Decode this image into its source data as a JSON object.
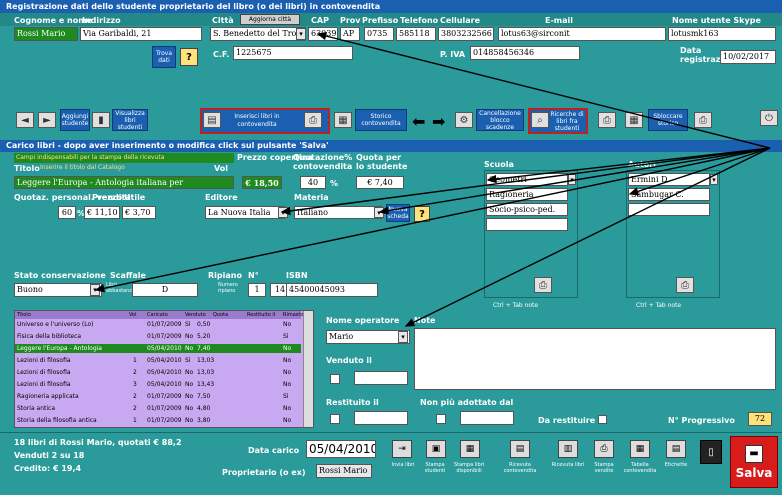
{
  "header": {
    "title": "Registrazione dati dello studente proprietario del libro (o dei libri) in contovendita",
    "cols": [
      "Cognome e nome",
      "Indirizzo",
      "Città",
      "CAP",
      "Prov",
      "Prefisso",
      "Telefono",
      "Cellulare",
      "E-mail",
      "Nome utente Skype"
    ],
    "aggiorna_citta": "Aggiorna città",
    "nome": "Rossi Mario",
    "indirizzo": "Via Garibaldi, 21",
    "citta": "S. Benedetto del Tronto",
    "cap": "63039",
    "prov": "AP",
    "prefisso": "0735",
    "telefono": "585118",
    "cellulare": "3803232566",
    "email": "lotus63@sirconit",
    "skype": "lotusmk163",
    "trova_btn": "Trova dati",
    "cf_label": "C.F.",
    "cf_value": "1225675",
    "piva_label": "P. IVA",
    "piva_value": "014858456346",
    "data_reg_label": "Data registrazione",
    "data_reg": "10/02/2017"
  },
  "toolbar": {
    "items": [
      "",
      "Aggiungi studente",
      "Visualizza libri studenti",
      "Inserisci libri in contovendita",
      "",
      "Storico contovendita",
      "",
      "",
      "Cancellazione blocco scadenze",
      "Ricerche di libri fra studenti",
      "",
      "Sbloccare storico",
      ""
    ]
  },
  "carico": {
    "title": "Carico libri - dopo aver inserimento o modifica click sul pulsante 'Salva'",
    "hint": "Campi indispensabili per la stampa della ricevuta",
    "titolo_label": "Titolo",
    "titolo_sub": "Inserire il titolo dal Catalogo",
    "vol_label": "Vol",
    "prezzo_copertina_label": "Prezzo copertina",
    "quotazione_label": "Quotazione% contovendita",
    "quota_label": "Quota per lo studente",
    "titolo": "Leggere l'Europa - Antologia italiana per",
    "prezzo_copertina": "€ 18,50",
    "quotazione": "40",
    "pct": "%",
    "quota": "€ 7,40",
    "quotaz_label": "Quotaz. personal. vendita",
    "quotaz_value": "60",
    "pct2": "%",
    "prezzo_label": "Prezzo",
    "prezzo": "€ 11,10",
    "utile_label": "Utile",
    "utile": "€ 3,70",
    "editore_label": "Editore",
    "editore": "La Nuova Italia",
    "materia_label": "Materia",
    "materia": "Italiano",
    "nuovo_btn": "Nuova scheda",
    "stato_label": "Stato conservazione",
    "stato": "Buono",
    "scaffale_label": "Scaffale",
    "libri_label": "Libri abbastanza",
    "scaffale": "D",
    "ripiano_label": "Ripiano",
    "n_label": "N°",
    "ripiano_small": "Numero ripiano",
    "ripiano": "1",
    "n": "14",
    "isbn_label": "ISBN",
    "isbn": "45400045093",
    "scuola_label": "Scuola",
    "scuole": [
      "Geometri",
      "Ragioneria",
      "Socio-psico-ped."
    ],
    "autori_label": "Autori",
    "autori": [
      "Ermini D.",
      "Sambugar C."
    ],
    "tab_note": "Ctrl + Tab note",
    "nome_operatore_label": "Nome operatore",
    "operatore": "Mario",
    "note_label": "Note",
    "venduto_label": "Venduto il",
    "restituito_label": "Restituito il",
    "non_adottato_label": "Non più adottato dal",
    "da_restituire_label": "Da restituire",
    "nprog_label": "N° Progressivo",
    "nprog": "72"
  },
  "books": {
    "headers": [
      "Titolo",
      "Vol",
      "Caricato",
      "Venduto",
      "Quota",
      "Restituito il",
      "Rimasto"
    ],
    "rows": [
      {
        "t": "Universo e l'universo (Lo)",
        "v": "",
        "d": "01/07/2009",
        "s": "Sì",
        "q": "0,50",
        "r": "No"
      },
      {
        "t": "Fisica della biblioteca",
        "v": "",
        "d": "01/07/2009",
        "s": "No",
        "q": "5,20",
        "r": "Sì"
      },
      {
        "t": "Leggere l'Europa - Antologia",
        "v": "",
        "d": "05/04/2010",
        "s": "No",
        "q": "7,40",
        "r": "No"
      },
      {
        "t": "Lezioni di filosofia",
        "v": "1",
        "d": "05/04/2010",
        "s": "Sì",
        "q": "13,03",
        "r": "No"
      },
      {
        "t": "Lezioni di filosofia",
        "v": "2",
        "d": "05/04/2010",
        "s": "No",
        "q": "13,03",
        "r": "No"
      },
      {
        "t": "Lezioni di filosofia",
        "v": "3",
        "d": "05/04/2010",
        "s": "No",
        "q": "13,43",
        "r": "No"
      },
      {
        "t": "Ragioneria applicata",
        "v": "2",
        "d": "01/07/2009",
        "s": "No",
        "q": "7,50",
        "r": "Sì"
      },
      {
        "t": "Storia antica",
        "v": "2",
        "d": "01/07/2009",
        "s": "No",
        "q": "4,80",
        "r": "No"
      },
      {
        "t": "Storia della filosofia antica",
        "v": "1",
        "d": "01/07/2009",
        "s": "No",
        "q": "3,80",
        "r": "No"
      }
    ]
  },
  "footer": {
    "summary": "18 libri di Rossi Mario, quotati € 88,2",
    "venduti": "Venduti 2 su 18",
    "credito": "Credito: € 19,4",
    "data_carico_label": "Data carico",
    "data_carico": "05/04/2010",
    "proprietario_label": "Proprietario (o ex)",
    "proprietario": "Rossi Mario",
    "buttons": [
      "Invia libri",
      "Stampa studenti",
      "Stampa libri disponibili",
      "Ricevuta contovendita",
      "Ricevuta libri",
      "Stampa vendite",
      "Tabella contovendita",
      "Etichette"
    ],
    "salva": "Salva"
  },
  "colors": {
    "teal": "#2a9a9a",
    "blue": "#1a5fb0",
    "highlight": "#1f8a1f",
    "purple": "#c8a8f0",
    "yellow": "#ffe27a",
    "salva": "#d81c1c"
  }
}
